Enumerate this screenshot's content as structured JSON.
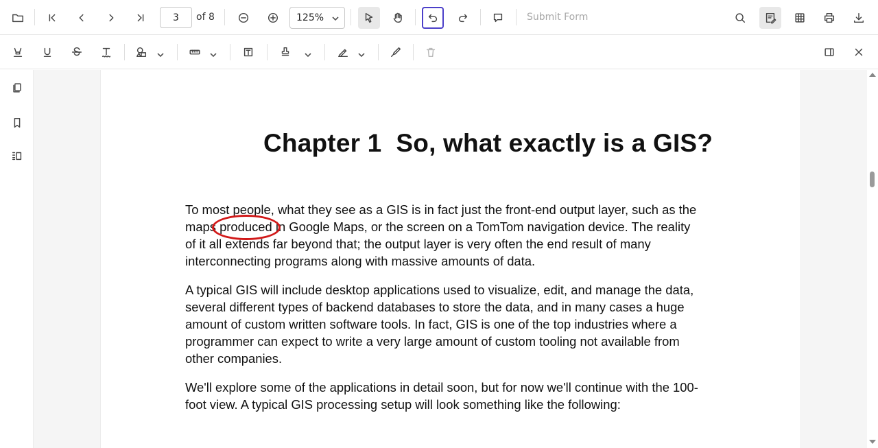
{
  "toolbar": {
    "page_number": "3",
    "page_of": "of 8",
    "zoom_value": "125%",
    "submit_label": "Submit Form"
  },
  "document": {
    "chapter_title": "Chapter 1  So, what exactly is a GIS?",
    "paragraphs": [
      [
        "To most people, what they see as a GIS is in fact just the front-end output layer, such as the",
        "maps produced in Google Maps, or the screen on a TomTom navigation device. The reality",
        "of it all extends far beyond that; the output layer is very often the end result of many",
        "interconnecting programs along with massive amounts of data."
      ],
      [
        "A typical GIS will include desktop applications used to visualize, edit, and manage the data,",
        "several different types of backend databases to store the data, and in many cases a huge",
        "amount of custom written software tools. In fact, GIS is one of the top industries where a",
        "programmer can expect to write a very large amount of custom tooling not available from",
        "other companies."
      ],
      [
        "We'll explore some of the applications in detail soon, but for now we'll continue with the 100-",
        "foot view. A typical GIS processing setup will look something like the following:"
      ]
    ]
  },
  "annotation": {
    "circled_word": "produced",
    "color": "#d11919"
  },
  "colors": {
    "accent_focus": "#4b3fc9",
    "active_bg": "#e8e8e8"
  }
}
